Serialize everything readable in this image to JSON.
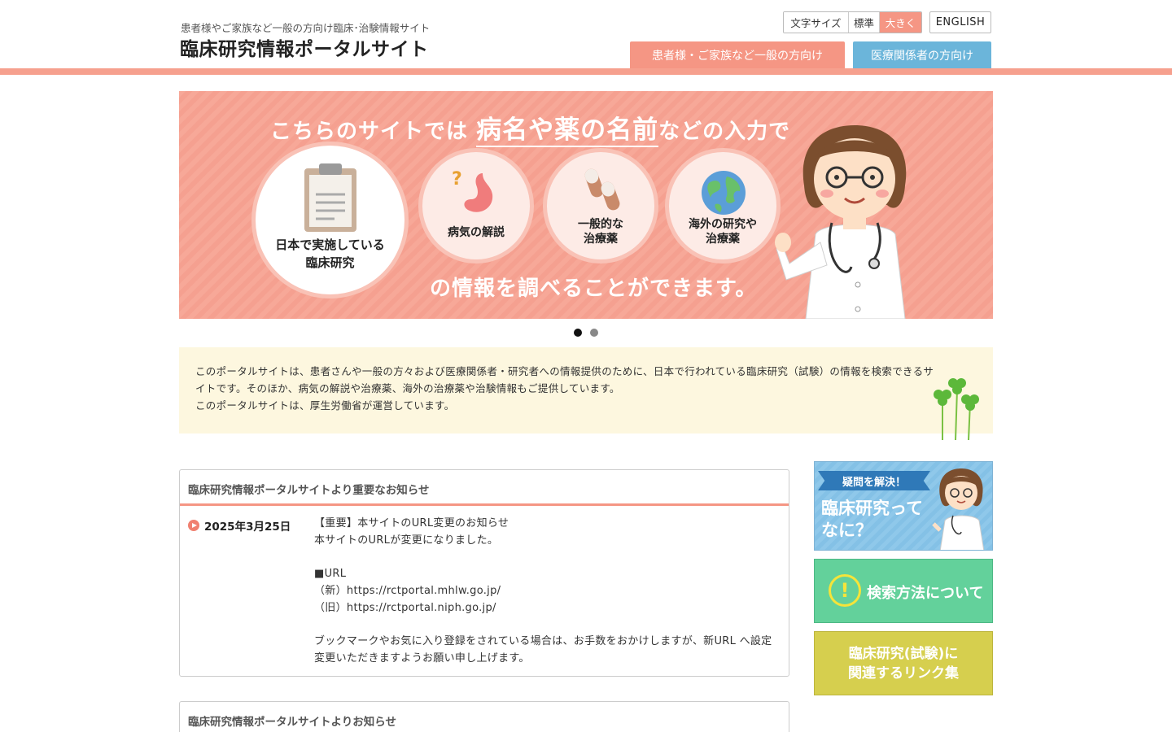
{
  "header": {
    "subtitle": "患者様やご家族など一般の方向け臨床･治験情報サイト",
    "title": "臨床研究情報ポータルサイト",
    "font_size_label": "文字サイズ",
    "font_size_standard": "標準",
    "font_size_large": "大きく",
    "english_label": "ENGLISH",
    "tab_general": "患者様・ご家族など一般の方向け",
    "tab_medical": "医療関係者の方向け"
  },
  "banner": {
    "headline_pre": "こちらのサイトでは",
    "headline_highlight": "病名や薬の名前",
    "headline_post": "などの入力で",
    "footer": "の情報を調べることができます。",
    "circle_1_line1": "日本で実施している",
    "circle_1_line2": "臨床研究",
    "circle_2_line1": "病気の解説",
    "circle_3_line1": "一般的な",
    "circle_3_line2": "治療薬",
    "circle_4_line1": "海外の研究や",
    "circle_4_line2": "治療薬",
    "slide_count": 2,
    "active_slide": 1
  },
  "intro": {
    "line1": "このポータルサイトは、患者さんや一般の方々および医療関係者・研究者への情報提供のために、日本で行われている臨床研究（試験）の情報を検索できるサイトです。そのほか、病気の解説や治療薬、海外の治療薬や治験情報もご提供しています。",
    "line2": "このポータルサイトは、厚生労働省が運営しています。"
  },
  "notices": {
    "important_title": "臨床研究情報ポータルサイトより重要なお知らせ",
    "important_date": "2025年3月25日",
    "important_lines": [
      "【重要】本サイトのURL変更のお知らせ",
      "本サイトのURLが変更になりました。",
      "",
      "■URL",
      "（新）https://rctportal.mhlw.go.jp/",
      "（旧）https://rctportal.niph.go.jp/",
      "",
      "ブックマークやお気に入り登録をされている場合は、お手数をおかけしますが、新URL へ設定変更いただきますようお願い申し上げます。"
    ],
    "general_title": "臨床研究情報ポータルサイトよりお知らせ"
  },
  "sidebar": {
    "box1_ribbon": "疑問を解決！",
    "box1_title_line1": "臨床研究って",
    "box1_title_line2": "なに？",
    "box2_title": "検索方法について",
    "box2_icon": "!",
    "box3_title_line1": "臨床研究(試験)に",
    "box3_title_line2": "関連するリンク集"
  },
  "colors": {
    "accent_pink": "#f59684",
    "accent_blue": "#6bb5da",
    "intro_bg": "#fdf7df"
  }
}
